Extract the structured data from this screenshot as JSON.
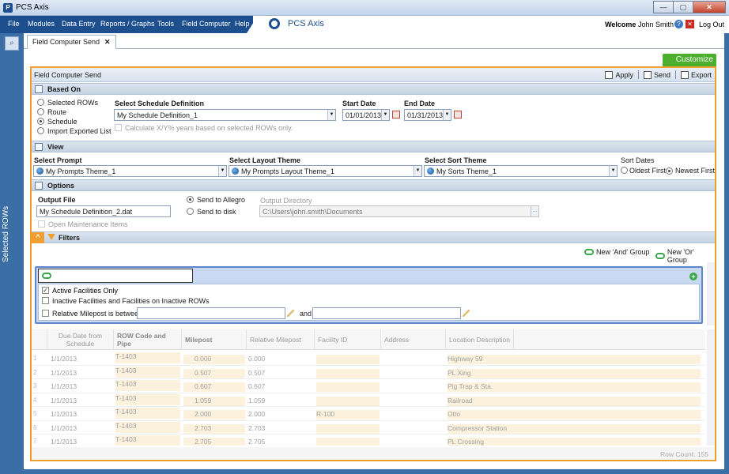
{
  "window": {
    "title": "PCS Axis",
    "minimize": "—",
    "maximize": "▢",
    "close": "✕"
  },
  "menu": [
    "File",
    "Modules",
    "Data Entry",
    "Reports / Graphs",
    "Tools",
    "Field Computer",
    "Help"
  ],
  "brand": {
    "name": "PCS Axis",
    "welcome": "Welcome",
    "user": "John Smith",
    "logout": "Log Out"
  },
  "left_rail": {
    "label": "Selected ROWs"
  },
  "tab": {
    "label": "Field Computer Send",
    "close": "✕"
  },
  "customize": "Customize",
  "panel": {
    "title": "Field Computer Send",
    "apply": "Apply",
    "send": "Send",
    "export": "Export"
  },
  "based_on": {
    "header": "Based On",
    "options": [
      "Selected ROWs",
      "Route",
      "Schedule",
      "Import Exported List"
    ],
    "selected": "Schedule",
    "schedule_label": "Select Schedule Definition",
    "schedule_value": "My Schedule Definition_1",
    "start_label": "Start Date",
    "start_value": "01/01/2013",
    "end_label": "End Date",
    "end_value": "01/31/2013",
    "calc_label": "Calculate X/Y% years based on selected ROWs only."
  },
  "view": {
    "header": "View",
    "prompt_label": "Select Prompt",
    "prompt_value": "My Prompts Theme_1",
    "layout_label": "Select Layout Theme",
    "layout_value": "My Prompts Layout Theme_1",
    "sort_label": "Select Sort Theme",
    "sort_value": "My Sorts Theme_1",
    "sort_dates_label": "Sort Dates",
    "oldest": "Oldest First",
    "newest": "Newest First"
  },
  "options": {
    "header": "Options",
    "output_file_label": "Output File",
    "output_file_value": "My Schedule Definition_2.dat",
    "send_allegro": "Send to Allegro",
    "send_disk": "Send to disk",
    "output_dir_label": "Output Directory",
    "output_dir_value": "C:\\Users\\john.smith\\Documents",
    "open_maint": "Open Maintenance Items"
  },
  "filters": {
    "header": "Filters",
    "new_and": "New 'And' Group",
    "new_or": "New 'Or' Group",
    "items": [
      {
        "label": "Active Facilities Only",
        "checked": true
      },
      {
        "label": "Inactive Facilities and Facilities on Inactive ROWs",
        "checked": false
      },
      {
        "label": "Relative Milepost is between",
        "checked": false
      }
    ],
    "and_label": "and"
  },
  "grid": {
    "columns": [
      "Due Date from Schedule",
      "ROW Code and Pipe",
      "Milepost",
      "Relative Milepost",
      "Facility ID",
      "Address",
      "Location Description"
    ],
    "rows": [
      {
        "n": "1",
        "due": "1/1/2013",
        "row": "T-1403",
        "mp": "0.000",
        "rmp": "0.000",
        "fid": "",
        "addr": "",
        "loc": "Highway 59"
      },
      {
        "n": "2",
        "due": "1/1/2013",
        "row": "T-1403",
        "mp": "0.507",
        "rmp": "0.507",
        "fid": "",
        "addr": "",
        "loc": "PL Xing"
      },
      {
        "n": "3",
        "due": "1/1/2013",
        "row": "T-1403",
        "mp": "0.607",
        "rmp": "0.607",
        "fid": "",
        "addr": "",
        "loc": "Pig Trap & Sta."
      },
      {
        "n": "4",
        "due": "1/1/2013",
        "row": "T-1403",
        "mp": "1.059",
        "rmp": "1.059",
        "fid": "",
        "addr": "",
        "loc": "Railroad"
      },
      {
        "n": "5",
        "due": "1/1/2013",
        "row": "T-1403",
        "mp": "2.000",
        "rmp": "2.000",
        "fid": "R-100",
        "addr": "",
        "loc": "Otto"
      },
      {
        "n": "6",
        "due": "1/1/2013",
        "row": "T-1403",
        "mp": "2.703",
        "rmp": "2.703",
        "fid": "",
        "addr": "",
        "loc": "Compressor Station"
      },
      {
        "n": "7",
        "due": "1/1/2013",
        "row": "T-1403",
        "mp": "2.705",
        "rmp": "2.705",
        "fid": "",
        "addr": "",
        "loc": "PL Crossing"
      }
    ],
    "row_count": "Row Count: 155"
  }
}
